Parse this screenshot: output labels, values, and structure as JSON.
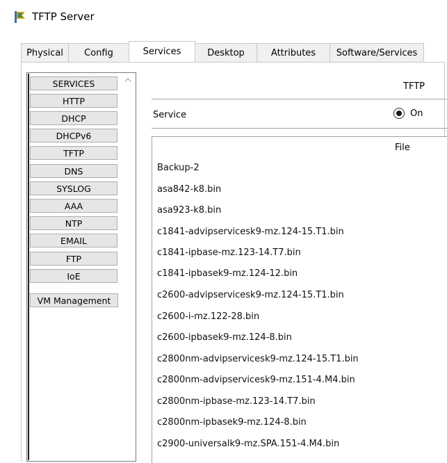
{
  "window": {
    "title": "TFTP Server",
    "icon": "tftp-server-icon"
  },
  "tabs": [
    {
      "label": "Physical",
      "active": false
    },
    {
      "label": "Config",
      "active": false
    },
    {
      "label": "Services",
      "active": true
    },
    {
      "label": "Desktop",
      "active": false
    },
    {
      "label": "Attributes",
      "active": false
    },
    {
      "label": "Software/Services",
      "active": false
    }
  ],
  "sidebar": {
    "items": [
      "SERVICES",
      "HTTP",
      "DHCP",
      "DHCPv6",
      "TFTP",
      "DNS",
      "SYSLOG",
      "AAA",
      "NTP",
      "EMAIL",
      "FTP",
      "IoE",
      "VM Management"
    ]
  },
  "tftp": {
    "header": "TFTP",
    "service_label": "Service",
    "service_state": "On",
    "file_header": "File",
    "files": [
      "Backup-2",
      "asa842-k8.bin",
      "asa923-k8.bin",
      "c1841-advipservicesk9-mz.124-15.T1.bin",
      "c1841-ipbase-mz.123-14.T7.bin",
      "c1841-ipbasek9-mz.124-12.bin",
      "c2600-advipservicesk9-mz.124-15.T1.bin",
      "c2600-i-mz.122-28.bin",
      "c2600-ipbasek9-mz.124-8.bin",
      "c2800nm-advipservicesk9-mz.124-15.T1.bin",
      "c2800nm-advipservicesk9-mz.151-4.M4.bin",
      "c2800nm-ipbase-mz.123-14.T7.bin",
      "c2800nm-ipbasek9-mz.124-8.bin",
      "c2900-universalk9-mz.SPA.151-4.M4.bin"
    ]
  }
}
